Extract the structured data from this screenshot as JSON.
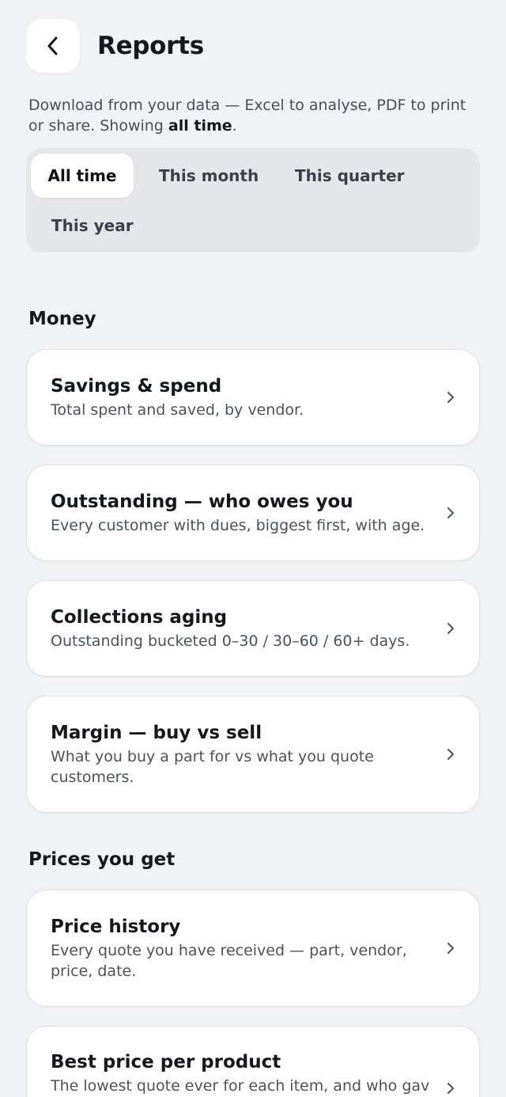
{
  "header": {
    "title": "Reports"
  },
  "intro": {
    "text": "Download from your data — Excel to analyse, PDF to print or share. Showing ",
    "range": "all time",
    "suffix": "."
  },
  "periods": [
    {
      "label": "All time",
      "active": true
    },
    {
      "label": "This month",
      "active": false
    },
    {
      "label": "This quarter",
      "active": false
    },
    {
      "label": "This year",
      "active": false
    }
  ],
  "sections": [
    {
      "title": "Money",
      "cards": [
        {
          "title": "Savings & spend",
          "desc": "Total spent and saved, by vendor."
        },
        {
          "title": "Outstanding — who owes you",
          "desc": "Every customer with dues, biggest first, with age."
        },
        {
          "title": "Collections aging",
          "desc": "Outstanding bucketed 0–30 / 30–60 / 60+ days."
        },
        {
          "title": "Margin — buy vs sell",
          "desc": "What you buy a part for vs what you quote customers."
        }
      ]
    },
    {
      "title": "Prices you get",
      "cards": [
        {
          "title": "Price history",
          "desc": "Every quote you have received — part, vendor, price, date."
        },
        {
          "title": "Best price per product",
          "desc": "The lowest quote ever for each item, and who gave"
        }
      ]
    }
  ]
}
